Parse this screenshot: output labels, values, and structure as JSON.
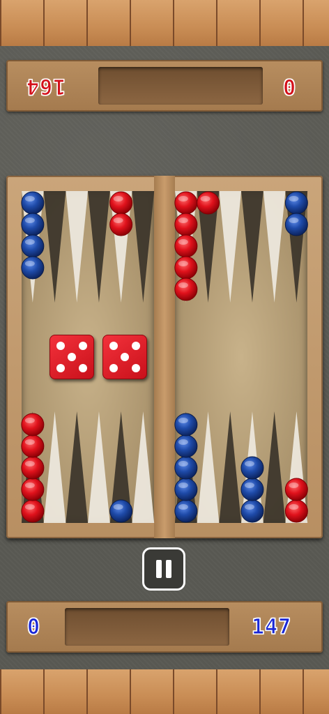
{
  "top_panel": {
    "score_right": "0",
    "score_left": "164"
  },
  "bottom_panel": {
    "score_left": "0",
    "score_right": "147"
  },
  "dice": [
    5,
    5
  ],
  "pause_icon": "pause-icon",
  "colors": {
    "red": "#d4101a",
    "blue": "#1a27d6"
  },
  "checkers": [
    {
      "point": "top-left-1",
      "color": "blue",
      "count": 4
    },
    {
      "point": "top-left-5",
      "color": "red",
      "count": 2
    },
    {
      "point": "top-right-1",
      "color": "red",
      "count": 5
    },
    {
      "point": "top-right-2",
      "color": "red",
      "count": 1
    },
    {
      "point": "top-right-6",
      "color": "blue",
      "count": 2
    },
    {
      "point": "bottom-left-1",
      "color": "red",
      "count": 5
    },
    {
      "point": "bottom-left-5",
      "color": "blue",
      "count": 1
    },
    {
      "point": "bottom-right-1",
      "color": "blue",
      "count": 5
    },
    {
      "point": "bottom-right-4",
      "color": "blue",
      "count": 3
    },
    {
      "point": "bottom-right-6",
      "color": "red",
      "count": 2
    }
  ]
}
